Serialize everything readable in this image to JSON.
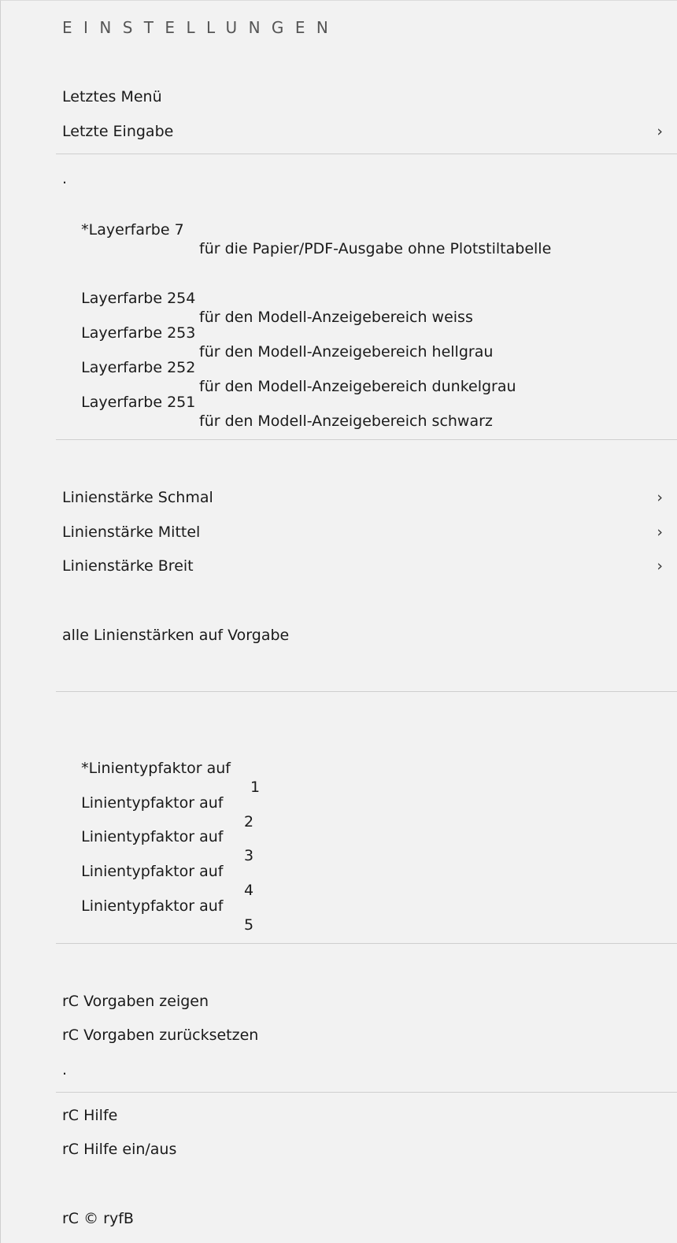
{
  "header": {
    "title": "EINSTELLUNGEN"
  },
  "items": {
    "letztes_menue": "Letztes Menü",
    "letzte_eingabe": "Letzte Eingabe",
    "dot1": ".",
    "layer7_label": "*Layerfarbe 7",
    "layer7_desc": "für die Papier/PDF-Ausgabe ohne Plotstiltabelle",
    "layer254_label": "Layerfarbe 254",
    "layer254_desc": "für den Modell-Anzeigebereich weiss",
    "layer253_label": "Layerfarbe 253",
    "layer253_desc": "für den Modell-Anzeigebereich hellgrau",
    "layer252_label": "Layerfarbe 252",
    "layer252_desc": "für den Modell-Anzeigebereich dunkelgrau",
    "layer251_label": "Layerfarbe 251",
    "layer251_desc": "für den Modell-Anzeigebereich schwarz",
    "ls_schmal": "Linienstärke Schmal",
    "ls_mittel": "Linienstärke Mittel",
    "ls_breit": "Linienstärke Breit",
    "ls_alle": "alle Linienstärken auf Vorgabe",
    "ltf1_label": "*Linientypfaktor auf",
    "ltf1_num": "1",
    "ltf2_label": "Linientypfaktor auf",
    "ltf2_num": "2",
    "ltf3_label": "Linientypfaktor auf",
    "ltf3_num": "3",
    "ltf4_label": "Linientypfaktor auf",
    "ltf4_num": "4",
    "ltf5_label": "Linientypfaktor auf",
    "ltf5_num": "5",
    "rc_zeigen": "rC Vorgaben zeigen",
    "rc_zurueck": "rC Vorgaben zurücksetzen",
    "dot2": ".",
    "rc_hilfe": "rC Hilfe",
    "rc_hilfe_toggle": "rC Hilfe ein/aus",
    "rc_copyright": "rC © ryfB"
  },
  "submenu_glyph": "›"
}
